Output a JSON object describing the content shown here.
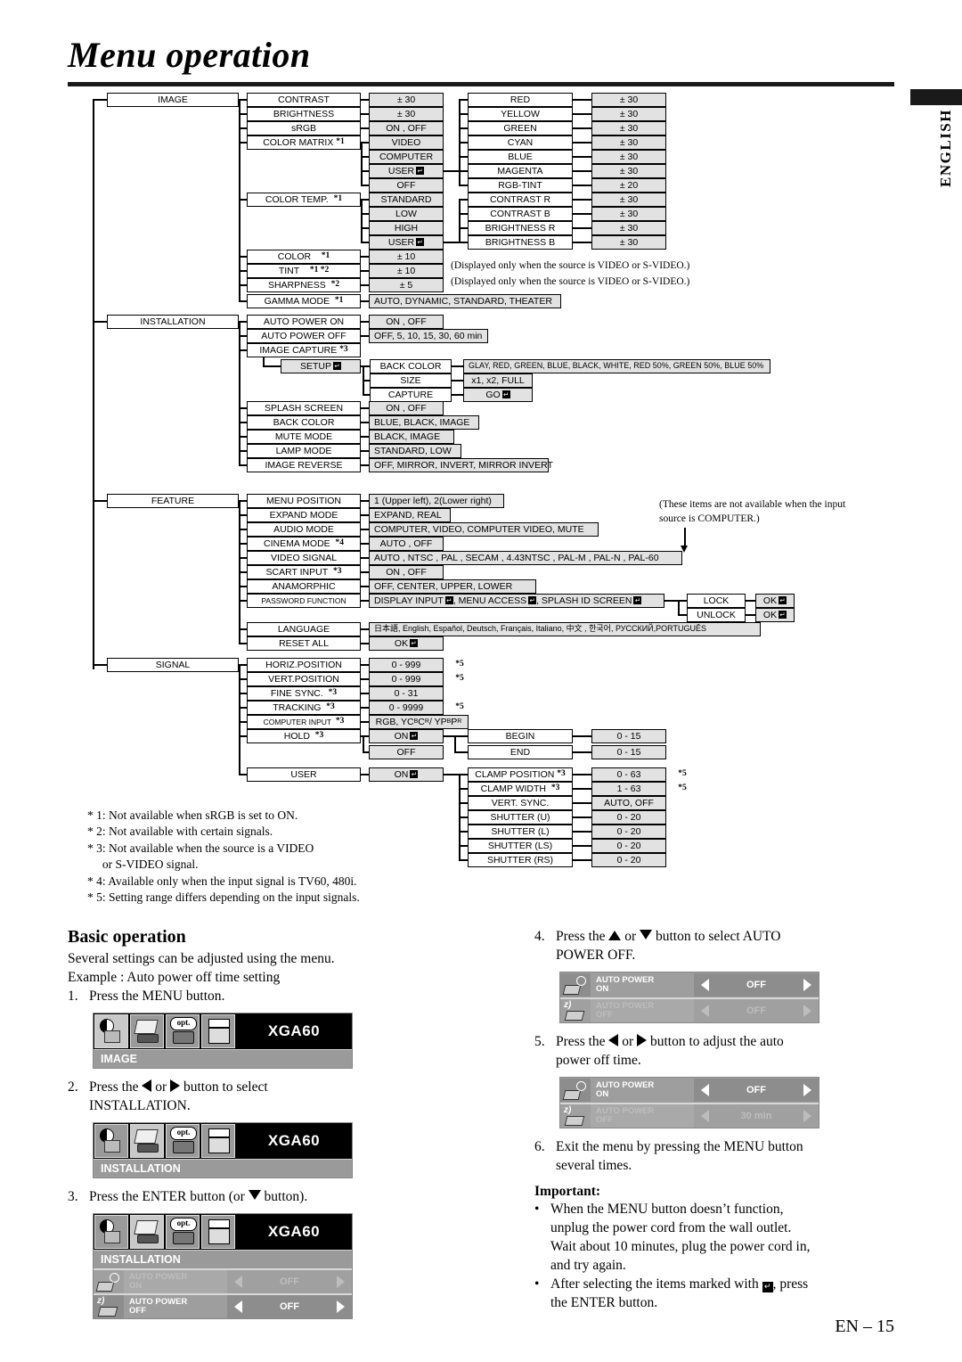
{
  "header": {
    "title": "Menu operation",
    "side_tab": "ENGLISH"
  },
  "footer": {
    "page": "EN – 15"
  },
  "tree": {
    "notes": [
      "(Displayed only when the source is VIDEO or S-VIDEO.)",
      "(Displayed only when the source is VIDEO or S-VIDEO.)",
      "(These items are not available when the input",
      "source is COMPUTER.)"
    ],
    "image": {
      "root": "IMAGE",
      "items": [
        {
          "label": "CONTRAST",
          "value": "± 30"
        },
        {
          "label": "BRIGHTNESS",
          "value": "± 30"
        },
        {
          "label": "sRGB",
          "value": "ON , OFF"
        },
        {
          "label": "COLOR MATRIX",
          "fn": "*1",
          "value": "VIDEO"
        },
        {
          "label": "",
          "value": "COMPUTER"
        },
        {
          "label": "",
          "value": "USER"
        },
        {
          "label": "",
          "value": "OFF"
        },
        {
          "label": "COLOR TEMP.",
          "fn": "*1",
          "value": "STANDARD"
        },
        {
          "label": "",
          "value": "LOW"
        },
        {
          "label": "",
          "value": "HIGH"
        },
        {
          "label": "",
          "value": "USER"
        },
        {
          "label": "COLOR",
          "fn": "*1",
          "value": "± 10"
        },
        {
          "label": "TINT",
          "fn": "*1 *2",
          "value": "± 10"
        },
        {
          "label": "SHARPNESS",
          "fn": "*2",
          "value": "± 5"
        },
        {
          "label": "GAMMA MODE",
          "fn": "*1",
          "value": "AUTO, DYNAMIC, STANDARD, THEATER"
        }
      ],
      "color_matrix_sub": [
        {
          "label": "RED",
          "value": "± 30"
        },
        {
          "label": "YELLOW",
          "value": "± 30"
        },
        {
          "label": "GREEN",
          "value": "± 30"
        },
        {
          "label": "CYAN",
          "value": "± 30"
        },
        {
          "label": "BLUE",
          "value": "± 30"
        },
        {
          "label": "MAGENTA",
          "value": "± 30"
        },
        {
          "label": "RGB-TINT",
          "value": "± 20"
        }
      ],
      "color_temp_sub": [
        {
          "label": "CONTRAST R",
          "value": "± 30"
        },
        {
          "label": "CONTRAST B",
          "value": "± 30"
        },
        {
          "label": "BRIGHTNESS R",
          "value": "± 30"
        },
        {
          "label": "BRIGHTNESS B",
          "value": "± 30"
        }
      ]
    },
    "installation": {
      "root": "INSTALLATION",
      "items": [
        {
          "label": "AUTO POWER ON",
          "value": "ON , OFF"
        },
        {
          "label": "AUTO POWER OFF",
          "value": "OFF,  5,  10,  15,  30,  60 min"
        },
        {
          "label": "IMAGE CAPTURE",
          "fn": "*3",
          "value": ""
        },
        {
          "label": "SPLASH SCREEN",
          "value": "ON , OFF"
        },
        {
          "label": "BACK COLOR",
          "value": "BLUE, BLACK, IMAGE"
        },
        {
          "label": "MUTE MODE",
          "value": "BLACK, IMAGE"
        },
        {
          "label": "LAMP MODE",
          "value": "STANDARD, LOW"
        },
        {
          "label": "IMAGE REVERSE",
          "value": "OFF, MIRROR, INVERT, MIRROR INVERT"
        }
      ],
      "setup_label": "SETUP",
      "setup_items": [
        {
          "label": "BACK COLOR",
          "value": "GLAY, RED, GREEN, BLUE, BLACK, WHITE, RED 50%, GREEN 50%, BLUE 50%"
        },
        {
          "label": "SIZE",
          "value": "x1, x2, FULL"
        },
        {
          "label": "CAPTURE",
          "value": "GO"
        }
      ]
    },
    "feature": {
      "root": "FEATURE",
      "items": [
        {
          "label": "MENU POSITION",
          "value": "1 (Upper left), 2(Lower right)"
        },
        {
          "label": "EXPAND MODE",
          "value": "EXPAND, REAL"
        },
        {
          "label": "AUDIO MODE",
          "value": "COMPUTER, VIDEO, COMPUTER VIDEO, MUTE"
        },
        {
          "label": "CINEMA MODE",
          "fn": "*4",
          "value": "AUTO , OFF"
        },
        {
          "label": "VIDEO SIGNAL",
          "value": "AUTO , NTSC , PAL , SECAM , 4.43NTSC , PAL-M , PAL-N , PAL-60"
        },
        {
          "label": "SCART INPUT",
          "fn": "*3",
          "value": "ON , OFF"
        },
        {
          "label": "ANAMORPHIC",
          "value": "OFF, CENTER, UPPER, LOWER"
        },
        {
          "label": "PASSWORD FUNCTION",
          "value": "DISPLAY INPUT , MENU ACCESS , SPLASH ID SCREEN"
        },
        {
          "label": "LANGUAGE",
          "value": "日本語, English, Español, Deutsch, Français, Italiano, 中文 , 한국어, РУССКИЙ,PORTUGUÊS"
        },
        {
          "label": "RESET ALL",
          "value": "OK"
        }
      ],
      "password_sub": [
        {
          "label": "LOCK",
          "value": "OK"
        },
        {
          "label": "UNLOCK",
          "value": "OK"
        }
      ]
    },
    "signal": {
      "root": "SIGNAL",
      "items": [
        {
          "label": "HORIZ.POSITION",
          "value": "0 - 999",
          "fn2": "*5"
        },
        {
          "label": "VERT.POSITION",
          "value": "0 - 999",
          "fn2": "*5"
        },
        {
          "label": "FINE SYNC.",
          "fn": "*3",
          "value": "0 - 31"
        },
        {
          "label": "TRACKING",
          "fn": "*3",
          "value": "0 - 9999",
          "fn2": "*5"
        },
        {
          "label": "COMPUTER INPUT",
          "fn": "*3",
          "value": "RGB, YCBCR / YPBPR"
        },
        {
          "label": "HOLD",
          "fn": "*3",
          "value": "ON"
        },
        {
          "label": "",
          "value": "OFF"
        },
        {
          "label": "USER",
          "value": "ON"
        }
      ],
      "hold_sub": [
        {
          "label": "BEGIN",
          "value": "0 - 15"
        },
        {
          "label": "END",
          "value": "0 - 15"
        }
      ],
      "user_sub": [
        {
          "label": "CLAMP POSITION",
          "fn": "*3",
          "value": "0 - 63",
          "fn2": "*5"
        },
        {
          "label": "CLAMP WIDTH",
          "fn": "*3",
          "value": "1 - 63",
          "fn2": "*5"
        },
        {
          "label": "VERT. SYNC.",
          "value": "AUTO, OFF"
        },
        {
          "label": "SHUTTER (U)",
          "value": "0 - 20"
        },
        {
          "label": "SHUTTER (L)",
          "value": "0 - 20"
        },
        {
          "label": "SHUTTER (LS)",
          "value": "0 - 20"
        },
        {
          "label": "SHUTTER (RS)",
          "value": "0 - 20"
        }
      ]
    }
  },
  "footnotes": [
    "* 1: Not available when sRGB is set to ON.",
    "* 2: Not available with certain signals.",
    "* 3: Not available when the source is a VIDEO",
    "     or S-VIDEO signal.",
    "* 4: Available only when the input signal is TV60, 480i.",
    "* 5: Setting range differs depending on the input signals."
  ],
  "basic": {
    "heading": "Basic operation",
    "intro_1": "Several settings can be adjusted using the menu.",
    "intro_2": "Example : Auto power off time setting",
    "step1_num": "1.",
    "step1_text": "Press the MENU button.",
    "step2_num": "2.",
    "step2_a": "Press the ",
    "step2_b": " or ",
    "step2_c": " button to select",
    "step2_d": "INSTALLATION.",
    "step3_num": "3.",
    "step3_a": "Press the ENTER button (or ",
    "step3_b": " button).",
    "step4_num": "4.",
    "step4_a": "Press the ",
    "step4_b": " or ",
    "step4_c": " button to select AUTO",
    "step4_d": "POWER OFF.",
    "step5_num": "5.",
    "step5_a": "Press the ",
    "step5_b": " or ",
    "step5_c": " button to adjust the auto",
    "step5_d": "power off time.",
    "step6_num": "6.",
    "step6_a": "Exit the menu by pressing the MENU button",
    "step6_b": "several times.",
    "important_title": "Important:",
    "bullet1_l1": "When the MENU button doesn’t function,",
    "bullet1_l2": "unplug the power cord from the wall outlet.",
    "bullet1_l3": "Wait about 10 minutes, plug the power cord in,",
    "bullet1_l4": "and try again.",
    "bullet2_a": "After selecting the items marked with ",
    "bullet2_b": ", press",
    "bullet2_c": "the ENTER button."
  },
  "osd": {
    "signal_label": "XGA60",
    "menu1_bar": "IMAGE",
    "menu2_bar": "INSTALLATION",
    "menu3_bar": "INSTALLATION",
    "row_ap_on_l1": "AUTO POWER",
    "row_ap_on_l2": "ON",
    "row_ap_off_l1": "AUTO POWER",
    "row_ap_off_l2": "OFF",
    "val_off": "OFF",
    "val_30min": "30 min"
  }
}
